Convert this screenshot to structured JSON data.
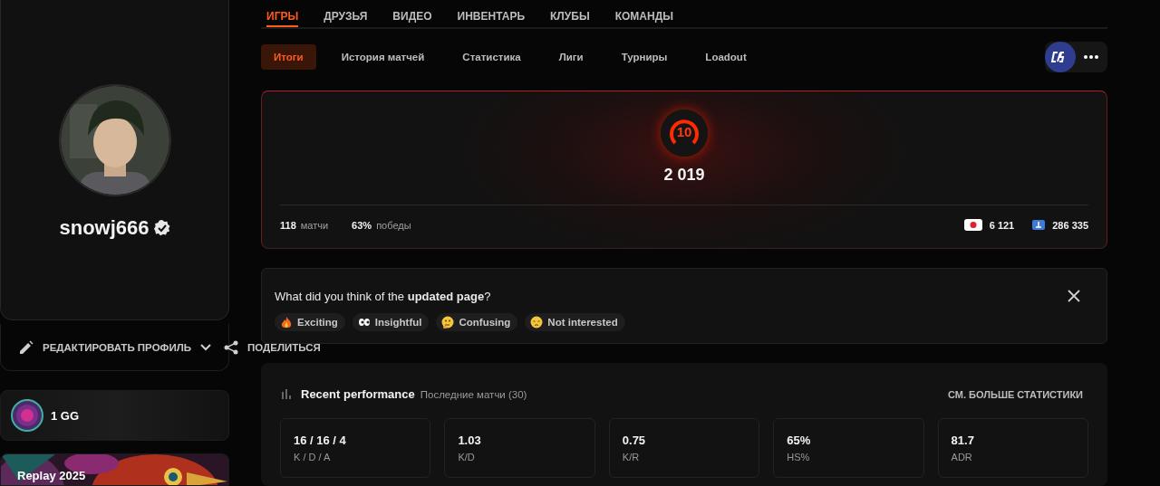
{
  "top_tabs": [
    {
      "label": "ИГРЫ",
      "selected": true
    },
    {
      "label": "ДРУЗЬЯ",
      "selected": false
    },
    {
      "label": "ВИДЕО",
      "selected": false
    },
    {
      "label": "ИНВЕНТАРЬ",
      "selected": false
    },
    {
      "label": "КЛУБЫ",
      "selected": false
    },
    {
      "label": "КОМАНДЫ",
      "selected": false
    }
  ],
  "sub_tabs": [
    {
      "label": "Итоги",
      "selected": true
    },
    {
      "label": "История матчей",
      "selected": false
    },
    {
      "label": "Статистика",
      "selected": false
    },
    {
      "label": "Лиги",
      "selected": false
    },
    {
      "label": "Турниры",
      "selected": false
    },
    {
      "label": "Loadout",
      "selected": false
    }
  ],
  "profile": {
    "username": "snowj666",
    "verified": true
  },
  "actions": [
    {
      "kind": "edit",
      "label": "РЕДАКТИРОВАТЬ ПРОФИЛЬ"
    },
    {
      "kind": "share",
      "label": "ПОДЕЛИТЬСЯ"
    }
  ],
  "banners": [
    {
      "kind": "gg",
      "label": "1 GG"
    },
    {
      "kind": "replay",
      "label": "Replay 2025"
    }
  ],
  "rank": {
    "level": "10",
    "elo": "2 019",
    "totals": [
      {
        "value": "118",
        "label": "матчи"
      },
      {
        "value": "63%",
        "label": "победы"
      }
    ],
    "badges": [
      {
        "kind": "flag",
        "value": "6 121"
      },
      {
        "kind": "region",
        "value": "286 335"
      }
    ]
  },
  "feedback": {
    "question": "What did you think of the **updated page**?",
    "options": [
      {
        "kind": "fire",
        "label": "Exciting"
      },
      {
        "kind": "eyes",
        "label": "Insightful"
      },
      {
        "kind": "thinking",
        "label": "Confusing"
      },
      {
        "kind": "sad",
        "label": "Not interested"
      }
    ]
  },
  "performance": {
    "title": "Recent performance",
    "subtitle": "Последние матчи (30)",
    "link": "СМ. БОЛЬШЕ СТАТИСТИКИ",
    "stats": [
      {
        "value": "16 / 16 / 4",
        "label": "K / D / A"
      },
      {
        "value": "1.03",
        "label": "K/D"
      },
      {
        "value": "0.75",
        "label": "K/R"
      },
      {
        "value": "65%",
        "label": "HS%"
      },
      {
        "value": "81.7",
        "label": "ADR"
      }
    ]
  }
}
